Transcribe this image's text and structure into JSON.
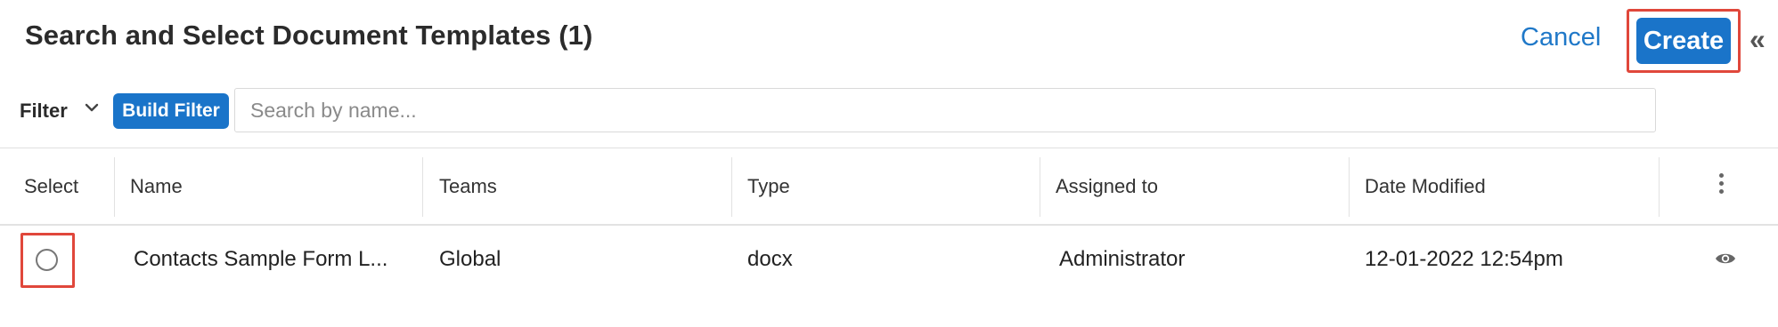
{
  "header": {
    "title": "Search and Select Document Templates (1)",
    "cancel_label": "Cancel",
    "create_label": "Create",
    "collapse_glyph": "«"
  },
  "filter": {
    "label": "Filter",
    "build_filter_label": "Build Filter",
    "search_placeholder": "Search by name...",
    "search_value": ""
  },
  "table": {
    "columns": [
      "Select",
      "Name",
      "Teams",
      "Type",
      "Assigned to",
      "Date Modified"
    ],
    "rows": [
      {
        "selected": false,
        "name": "Contacts Sample Form L...",
        "teams": "Global",
        "type": "docx",
        "assigned_to": "Administrator",
        "date_modified": "12-01-2022 12:54pm"
      }
    ]
  },
  "icons": {
    "filter_chevron": "chevron-down-icon",
    "collapse": "double-chevron-left-icon",
    "column_options": "kebab-menu-icon",
    "preview": "eye-icon"
  },
  "colors": {
    "accent": "#1a74c9",
    "link": "#1f78c8",
    "highlight": "#e0473b"
  }
}
